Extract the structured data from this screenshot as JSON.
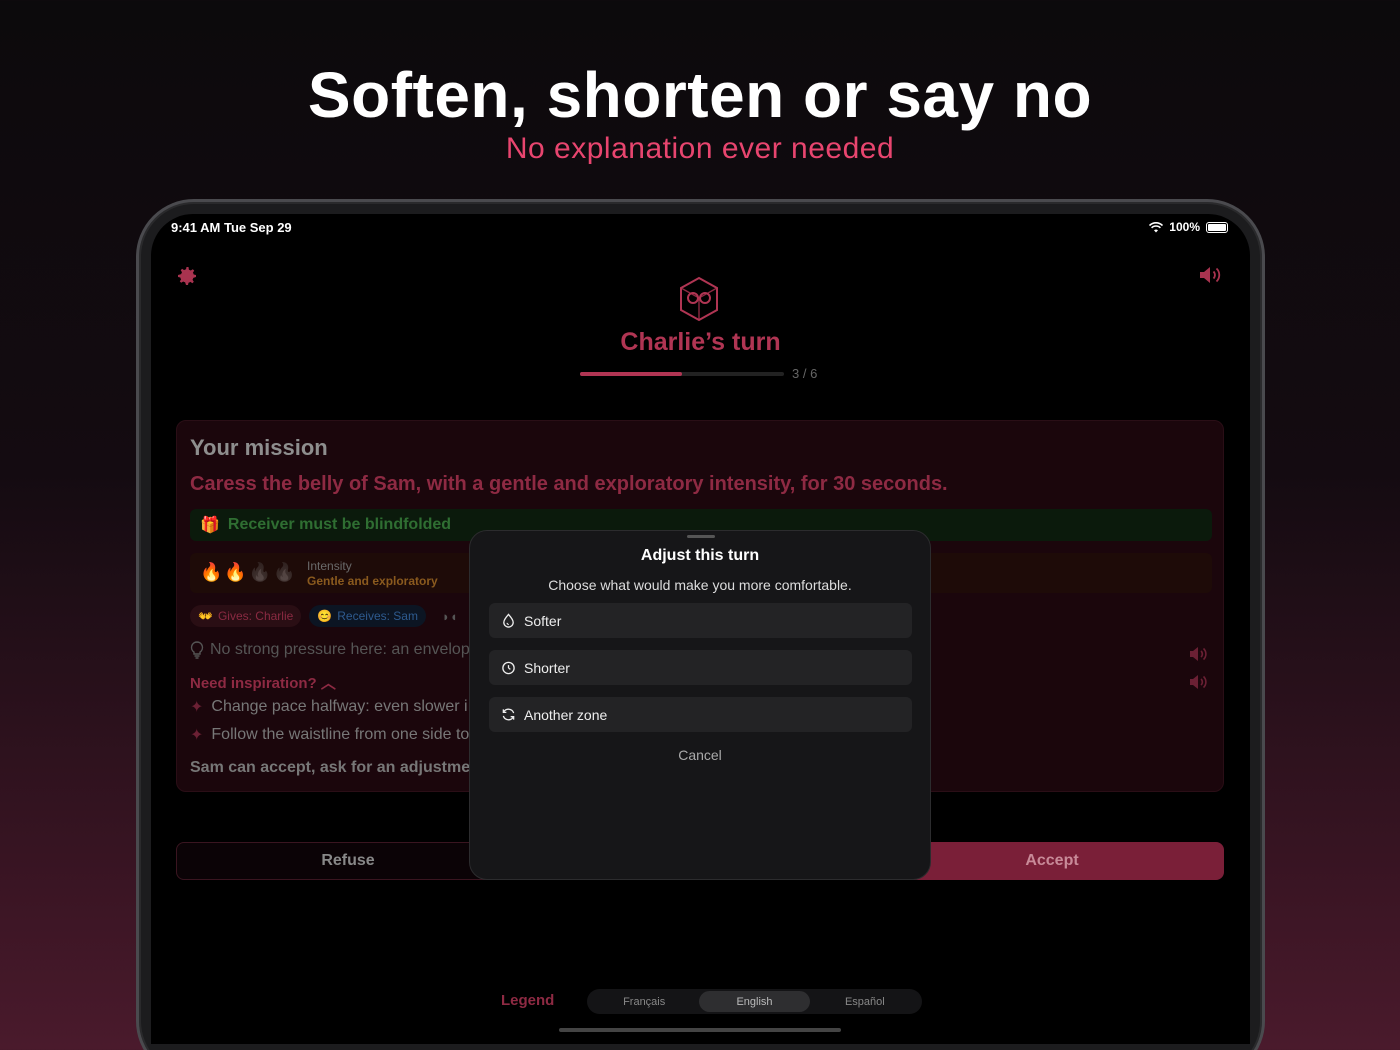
{
  "promo": {
    "headline": "Soften, shorten or say no",
    "subheadline": "No explanation ever needed"
  },
  "status_bar": {
    "time": "9:41 AM  Tue Sep 29",
    "battery": "100%"
  },
  "header": {
    "turn_title": "Charlie’s turn",
    "progress_label": "3 / 6",
    "progress_current": 3,
    "progress_total": 6
  },
  "mission": {
    "heading": "Your mission",
    "text": "Caress the belly of Sam, with a gentle and exploratory intensity, for 30 seconds.",
    "blindfold_note": "Receiver must be blindfolded",
    "intensity_label": "Intensity",
    "intensity_value": "Gentle and exploratory",
    "intensity_level": 2,
    "intensity_max": 4,
    "gives_chip": "Gives: Charlie",
    "receives_chip": "Receives: Sam",
    "tip": "No strong pressure here: an envelop",
    "inspiration_toggle": "Need inspiration?",
    "inspiration_items": [
      "Change pace halfway: even slower i",
      "Follow the waistline from one side to"
    ],
    "accept_note": "Sam can accept, ask for an adjustmen"
  },
  "actions": {
    "refuse": "Refuse",
    "accept": "Accept"
  },
  "sheet": {
    "title": "Adjust this turn",
    "subtitle": "Choose what would make you more comfortable.",
    "options": [
      "Softer",
      "Shorter",
      "Another zone"
    ],
    "cancel": "Cancel"
  },
  "footer": {
    "legend": "Legend",
    "languages": [
      "Français",
      "English",
      "Español"
    ],
    "active_language": "English"
  },
  "colors": {
    "accent": "#b03553",
    "subheadline": "#e8456f"
  }
}
